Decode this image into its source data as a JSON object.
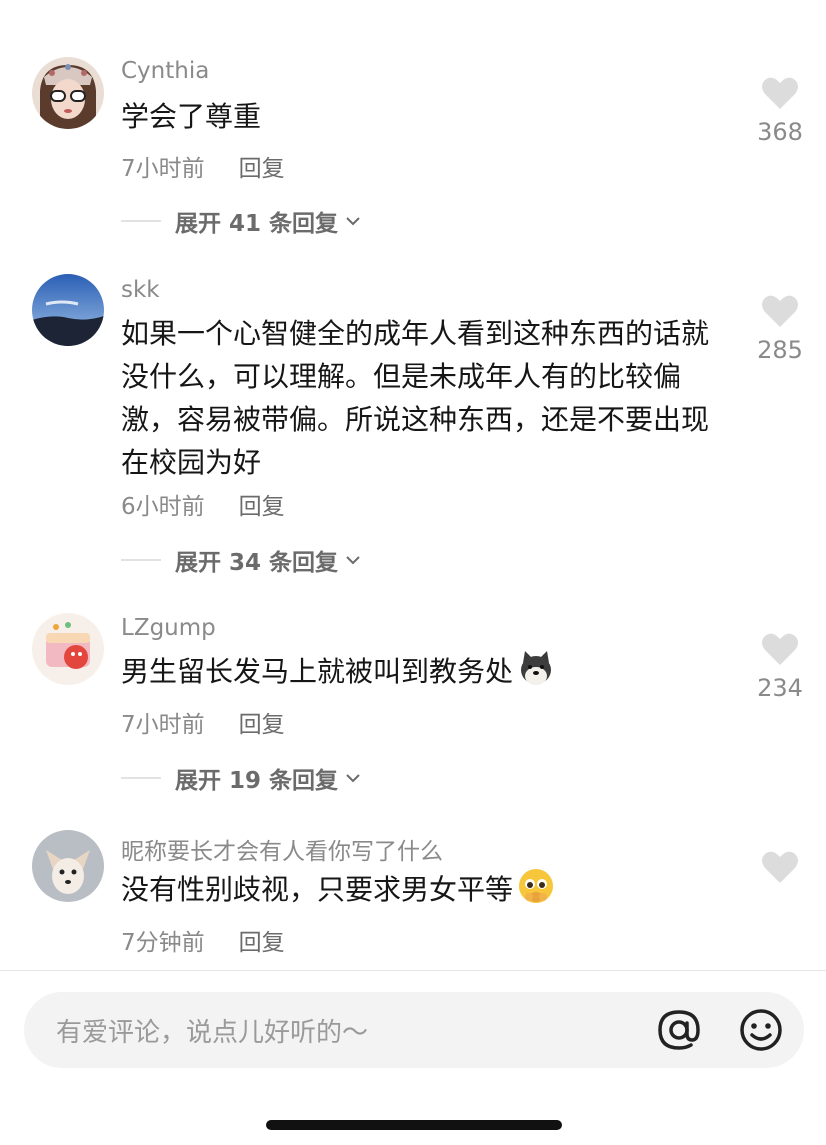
{
  "comments": [
    {
      "username": "Cynthia",
      "text": "学会了尊重",
      "time": "7小时前",
      "reply": "回复",
      "likes": "368",
      "expand": "展开 41 条回复",
      "avatar": "avatar-girl-sunglasses"
    },
    {
      "username": "skk",
      "text": "如果一个心智健全的成年人看到这种东西的话就没什么，可以理解。但是未成年人有的比较偏激，容易被带偏。所说这种东西，还是不要出现在校园为好",
      "time": "6小时前",
      "reply": "回复",
      "likes": "285",
      "expand": "展开 34 条回复",
      "avatar": "avatar-sky-landscape"
    },
    {
      "username": "LZgump",
      "text": "男生留长发马上就被叫到教务处",
      "time": "7小时前",
      "reply": "回复",
      "likes": "234",
      "expand": "展开 19 条回复",
      "avatar": "avatar-cartoon-cake",
      "emoji": "dog-emoji"
    },
    {
      "username": "昵称要长才会有人看你写了什么",
      "text": "没有性别歧视，只要求男女平等",
      "time": "7分钟前",
      "reply": "回复",
      "likes": "",
      "avatar": "avatar-chihuahua",
      "emoji": "pleading-face-emoji"
    }
  ],
  "input": {
    "placeholder": "有爱评论，说点儿好听的～",
    "at_icon": "at-icon",
    "emoji_icon": "smiley-icon"
  },
  "colors": {
    "text": "#161616",
    "muted": "#8a8a8a",
    "heart": "#dcdcdc",
    "input_bg": "#f3f3f3"
  }
}
